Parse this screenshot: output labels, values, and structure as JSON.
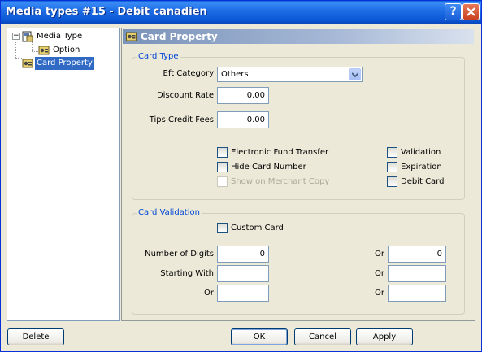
{
  "window": {
    "title": "Media types #15 - Debit canadien"
  },
  "tree": {
    "items": [
      {
        "label": "Media Type"
      },
      {
        "label": "Option"
      },
      {
        "label": "Card Property"
      }
    ]
  },
  "panel": {
    "header": "Card Property",
    "card_type": {
      "title": "Card Type",
      "eft_category_label": "Eft Category",
      "eft_category_value": "Others",
      "discount_rate_label": "Discount Rate",
      "discount_rate_value": "0.00",
      "tips_credit_fees_label": "Tips Credit Fees",
      "tips_credit_fees_value": "0.00",
      "checkboxes": [
        {
          "label": "Electronic Fund Transfer"
        },
        {
          "label": "Hide Card Number"
        },
        {
          "label": "Show on Merchant Copy"
        },
        {
          "label": "Validation"
        },
        {
          "label": "Expiration"
        },
        {
          "label": "Debit Card"
        }
      ]
    },
    "card_validation": {
      "title": "Card Validation",
      "custom_card_label": "Custom Card",
      "number_of_digits_label": "Number of Digits",
      "number_of_digits_value": "0",
      "or_label": "Or",
      "number_of_digits_or_value": "0",
      "starting_with_label": "Starting With",
      "starting_with_value": "",
      "starting_with_or_value": "",
      "or_row_value": "",
      "or_row_or_value": ""
    }
  },
  "buttons": {
    "delete": "Delete",
    "ok": "OK",
    "cancel": "Cancel",
    "apply": "Apply"
  },
  "colors": {
    "titlebar": "#0b55d2",
    "selection": "#316ac5",
    "group_title": "#0046d5"
  },
  "icons": [
    "help-icon",
    "close-icon",
    "tree-expand-icon",
    "media-type-icon",
    "option-icon",
    "card-property-icon",
    "dropdown-arrow-icon"
  ]
}
